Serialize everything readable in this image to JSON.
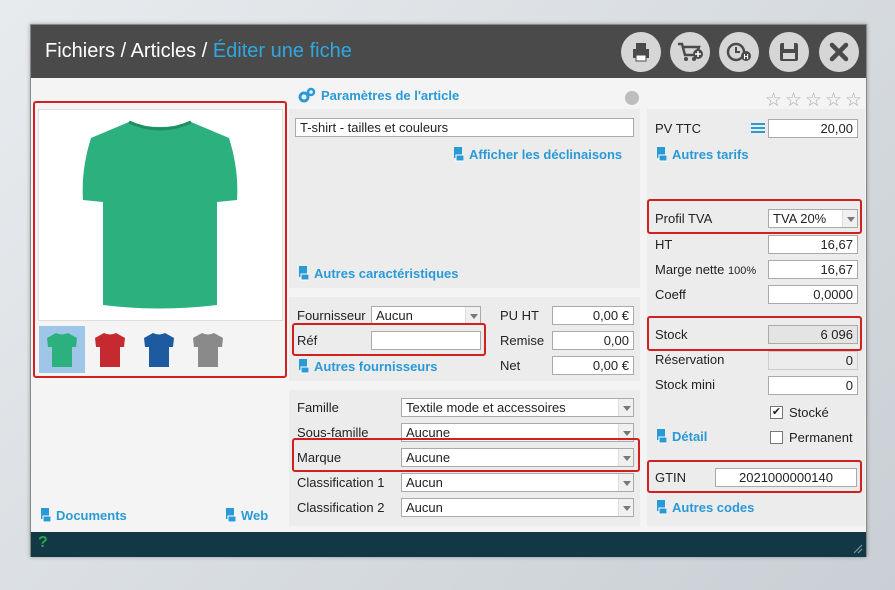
{
  "breadcrumb": {
    "part1": "Fichiers",
    "sep1": " / ",
    "part2": "Articles",
    "sep2": " / ",
    "current": "Éditer une fiche"
  },
  "toolbar": {
    "icons": [
      "print-icon",
      "cart-add-icon",
      "clock-history-icon",
      "save-icon",
      "close-icon"
    ]
  },
  "article": {
    "section_title": "Paramètres de l'article",
    "name": "T-shirt - tailles et couleurs",
    "show_variants": "Afficher les déclinaisons",
    "other_characteristics": "Autres caractéristiques"
  },
  "supplier": {
    "fournisseur_label": "Fournisseur",
    "fournisseur_value": "Aucun",
    "ref_label": "Réf",
    "ref_value": "",
    "other_suppliers": "Autres fournisseurs",
    "puht_label": "PU HT",
    "puht_value": "0,00 €",
    "remise_label": "Remise",
    "remise_value": "0,00",
    "net_label": "Net",
    "net_value": "0,00 €"
  },
  "classification": {
    "famille_label": "Famille",
    "famille_value": "Textile mode et accessoires",
    "sousfamille_label": "Sous-famille",
    "sousfamille_value": "Aucune",
    "marque_label": "Marque",
    "marque_value": "Aucune",
    "class1_label": "Classification 1",
    "class1_value": "Aucun",
    "class2_label": "Classification 2",
    "class2_value": "Aucun"
  },
  "pricing": {
    "pvttc_label": "PV TTC",
    "pvttc_value": "20,00",
    "other_prices": "Autres tarifs",
    "profil_tva_label": "Profil TVA",
    "profil_tva_value": "TVA 20%",
    "ht_label": "HT",
    "ht_value": "16,67",
    "marge_label": "Marge nette",
    "marge_pct": "100%",
    "marge_value": "16,67",
    "coeff_label": "Coeff",
    "coeff_value": "0,0000"
  },
  "stock": {
    "stock_label": "Stock",
    "stock_value": "6 096",
    "reservation_label": "Réservation",
    "reservation_value": "0",
    "stock_mini_label": "Stock mini",
    "stock_mini_value": "0",
    "stocke_label": "Stocké",
    "stocke_checked": "✔",
    "detail": "Détail",
    "permanent_label": "Permanent"
  },
  "codes": {
    "gtin_label": "GTIN",
    "gtin_value": "2021000000140",
    "other_codes": "Autres codes"
  },
  "left": {
    "documents": "Documents",
    "web": "Web"
  },
  "rating": {
    "stars": "☆☆☆☆☆",
    "value": 0
  },
  "thumbnails": [
    {
      "color": "#2bb07e",
      "name": "green"
    },
    {
      "color": "#c42a2f",
      "name": "red"
    },
    {
      "color": "#1e5aa0",
      "name": "blue"
    },
    {
      "color": "#8a8a8a",
      "name": "gray"
    }
  ],
  "status": {
    "help": "?"
  },
  "colors": {
    "accent": "#2ea8df",
    "titlebar": "#4a4a4a",
    "statusbar": "#123845",
    "highlight": "#d21f1f"
  }
}
